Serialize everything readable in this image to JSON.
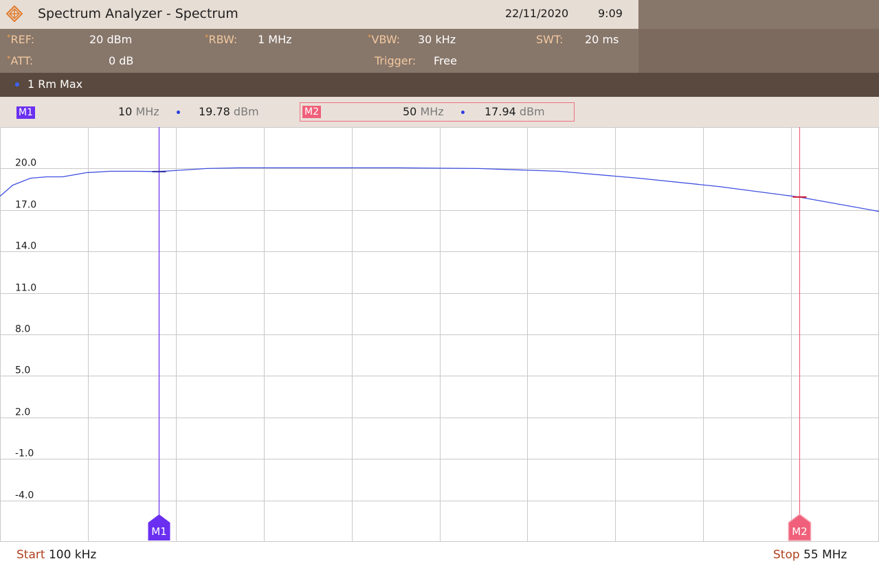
{
  "window": {
    "title": "Spectrum Analyzer - Spectrum",
    "date": "22/11/2020",
    "time": "9:09"
  },
  "params": {
    "ref": {
      "label": "REF:",
      "value": "20 dBm"
    },
    "att": {
      "label": "ATT:",
      "value": "0 dB"
    },
    "rbw": {
      "label": "RBW:",
      "value": "1 MHz"
    },
    "vbw": {
      "label": "VBW:",
      "value": "30 kHz"
    },
    "trigger": {
      "label": "Trigger:",
      "value": "Free"
    },
    "swt": {
      "label": "SWT:",
      "value": "20 ms"
    }
  },
  "trace": {
    "label": "1 Rm  Max"
  },
  "markers": {
    "m1": {
      "badge": "M1",
      "freq": "10",
      "freq_unit": "MHz",
      "level": "19.78",
      "level_unit": "dBm",
      "color": "#6a2ff0"
    },
    "m2": {
      "badge": "M2",
      "freq": "50",
      "freq_unit": "MHz",
      "level": "17.94",
      "level_unit": "dBm",
      "color": "#f0607a"
    }
  },
  "axis": {
    "start_label": "Start",
    "start_value": "100 kHz",
    "stop_label": "Stop",
    "stop_value": "55 MHz"
  },
  "chart_data": {
    "type": "line",
    "x_unit": "MHz",
    "xlim": [
      0.1,
      55
    ],
    "ylim": [
      -7,
      23
    ],
    "y_ticks": [
      20.0,
      17.0,
      14.0,
      11.0,
      8.0,
      5.0,
      2.0,
      -1.0,
      -4.0
    ],
    "y_tick_labels": [
      "20.0",
      "17.0",
      "14.0",
      "11.0",
      "8.0",
      "5.0",
      "2.0",
      "-1.0",
      "-4.0"
    ],
    "grid": true,
    "trace_color": "#3e4fe0",
    "series": [
      {
        "x": [
          0.1,
          0.9,
          2.0,
          3.0,
          4.0,
          5.5,
          7.0,
          8.5,
          10.0,
          11.0,
          13.0,
          15.0,
          20.0,
          25.0,
          30.0,
          35.0,
          40.0,
          45.0,
          50.0,
          55.0
        ],
        "values": [
          18.0,
          18.8,
          19.3,
          19.4,
          19.4,
          19.7,
          19.8,
          19.8,
          19.78,
          19.85,
          20.0,
          20.05,
          20.05,
          20.05,
          20.0,
          19.8,
          19.3,
          18.7,
          17.94,
          16.9
        ]
      }
    ],
    "marker_lines": [
      {
        "label": "M1",
        "x": 10.0,
        "y": 19.78,
        "color": "#6a2ff0"
      },
      {
        "label": "M2",
        "x": 50.0,
        "y": 17.94,
        "color": "#f0607a"
      }
    ]
  }
}
